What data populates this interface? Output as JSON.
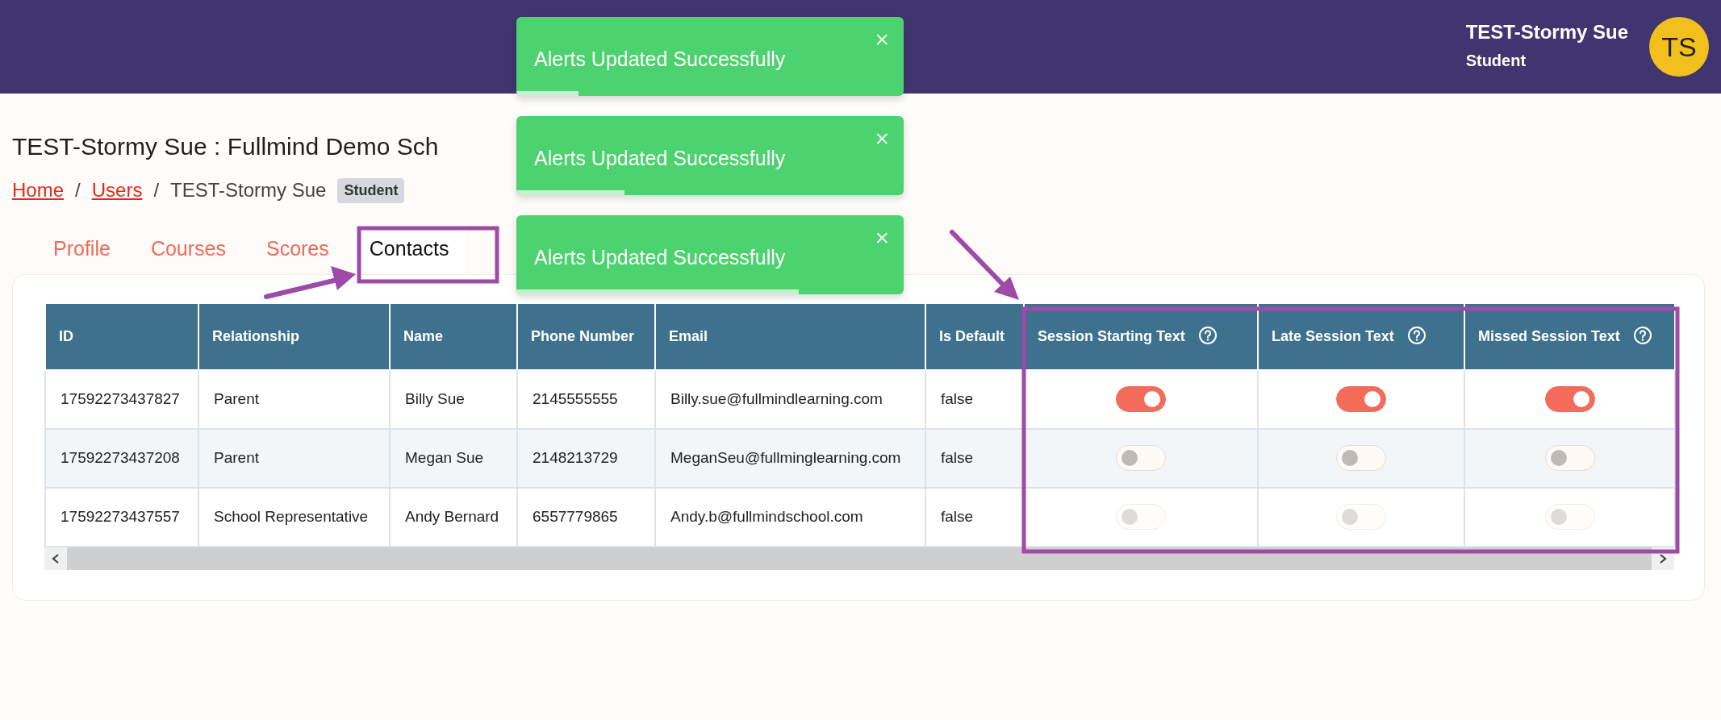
{
  "header": {
    "user_name": "TEST-Stormy Sue",
    "user_role": "Student",
    "avatar_initials": "TS"
  },
  "toasts": [
    {
      "message": "Alerts Updated Successfully",
      "close": "×",
      "level": 0.16
    },
    {
      "message": "Alerts Updated Successfully",
      "close": "×",
      "level": 0.28
    },
    {
      "message": "Alerts Updated Successfully",
      "close": "×",
      "level": 0.73
    }
  ],
  "page_title": "TEST-Stormy Sue : Fullmind Demo Sch",
  "breadcrumb": [
    {
      "label": "Home",
      "kind": "link"
    },
    {
      "label": "Users",
      "kind": "link"
    },
    {
      "label": "TEST-Stormy Sue",
      "kind": "current"
    }
  ],
  "breadcrumb_separator": "/",
  "role_badge": "Student",
  "tabs": [
    {
      "label": "Profile",
      "selected": false
    },
    {
      "label": "Courses",
      "selected": false
    },
    {
      "label": "Scores",
      "selected": false
    },
    {
      "label": "Contacts",
      "selected": true
    }
  ],
  "table": {
    "columns": [
      {
        "label": "ID",
        "help": false
      },
      {
        "label": "Relationship",
        "help": false
      },
      {
        "label": "Name",
        "help": false
      },
      {
        "label": "Phone Number",
        "help": false
      },
      {
        "label": "Email",
        "help": false
      },
      {
        "label": "Is Default",
        "help": false
      },
      {
        "label": "Session Starting Text",
        "help": true
      },
      {
        "label": "Late Session Text",
        "help": true
      },
      {
        "label": "Missed Session Text",
        "help": true
      }
    ],
    "rows": [
      {
        "cells": [
          "17592273437827",
          "Parent",
          "Billy Sue",
          "2145555555",
          "Billy.sue@fullmindlearning.com",
          "false"
        ],
        "toggles": [
          {
            "on": true,
            "disabled": false
          },
          {
            "on": true,
            "disabled": false
          },
          {
            "on": true,
            "disabled": false
          }
        ]
      },
      {
        "cells": [
          "17592273437208",
          "Parent",
          "Megan Sue",
          "2148213729",
          "MeganSeu@fullminglearning.com",
          "false"
        ],
        "toggles": [
          {
            "on": false,
            "disabled": false
          },
          {
            "on": false,
            "disabled": false
          },
          {
            "on": false,
            "disabled": false
          }
        ]
      },
      {
        "cells": [
          "17592273437557",
          "School Representative",
          "Andy Bernard",
          "6557779865",
          "Andy.b@fullmindschool.com",
          "false"
        ],
        "toggles": [
          {
            "on": false,
            "disabled": true
          },
          {
            "on": false,
            "disabled": true
          },
          {
            "on": false,
            "disabled": true
          }
        ]
      }
    ]
  }
}
